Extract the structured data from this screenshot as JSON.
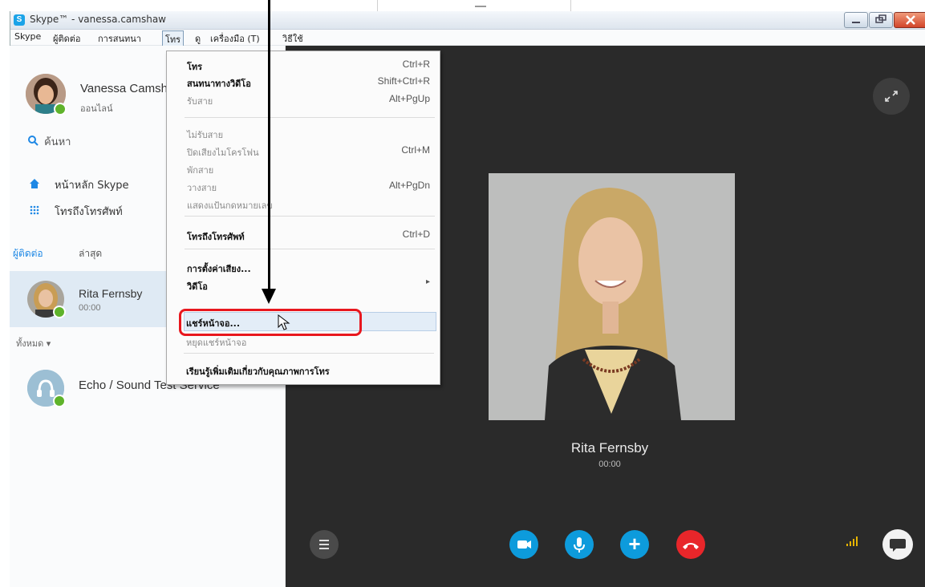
{
  "window": {
    "title": "Skype™ - vanessa.camshaw",
    "app_icon": "S"
  },
  "menubar": {
    "items": [
      "Skype",
      "ผู้ติดต่อ",
      "การสนทนา",
      "โทร",
      "ดู",
      "เครื่องมือ (T)",
      "วิธีใช้"
    ]
  },
  "sidebar": {
    "profile_name": "Vanessa Camsh",
    "profile_status": "ออนไลน์",
    "search_label": "ค้นหา",
    "home_label": "หน้าหลัก Skype",
    "dialpad_label": "โทรถึงโทรศัพท์",
    "tabs": [
      "ผู้ติดต่อ",
      "ล่าสุด"
    ],
    "recent_contact_name": "Rita Fernsby",
    "recent_contact_time": "00:00",
    "filter_label": "ทั้งหมด ▾",
    "echo_name": "Echo / Sound Test Service"
  },
  "call": {
    "caller_name": "Rita Fernsby",
    "caller_time": "00:00"
  },
  "call_menu": {
    "items": [
      {
        "label": "โทร",
        "shortcut": "Ctrl+R"
      },
      {
        "label": "สนทนาทางวิดีโอ",
        "shortcut": "Shift+Ctrl+R"
      },
      {
        "label": "รับสาย",
        "shortcut": "Alt+PgUp"
      },
      {
        "label": "ไม่รับสาย",
        "shortcut": ""
      },
      {
        "label": "ปิดเสียงไมโครโฟน",
        "shortcut": "Ctrl+M"
      },
      {
        "label": "พักสาย",
        "shortcut": ""
      },
      {
        "label": "วางสาย",
        "shortcut": "Alt+PgDn"
      },
      {
        "label": "แสดงแป้นกดหมายเลข",
        "shortcut": ""
      },
      {
        "label": "โทรถึงโทรศัพท์",
        "shortcut": "Ctrl+D"
      },
      {
        "label": "การตั้งค่าเสียง...",
        "shortcut": ""
      },
      {
        "label": "วิดีโอ",
        "shortcut": "▸"
      },
      {
        "label": "แชร์หน้าจอ...",
        "shortcut": ""
      },
      {
        "label": "หยุดแชร์หน้าจอ",
        "shortcut": ""
      },
      {
        "label": "เรียนรู้เพิ่มเติมเกี่ยวกับคุณภาพการโทร",
        "shortcut": ""
      }
    ]
  },
  "icons": {
    "search": "search-icon",
    "home": "home-icon",
    "dialpad": "dialpad-icon",
    "expand": "expand-icon",
    "signal": "signal-icon"
  },
  "colors": {
    "skype_blue": "#0d9bdc",
    "hangup_red": "#e8262a",
    "online_green": "#5fb32b",
    "highlight_red": "#e8171e"
  }
}
